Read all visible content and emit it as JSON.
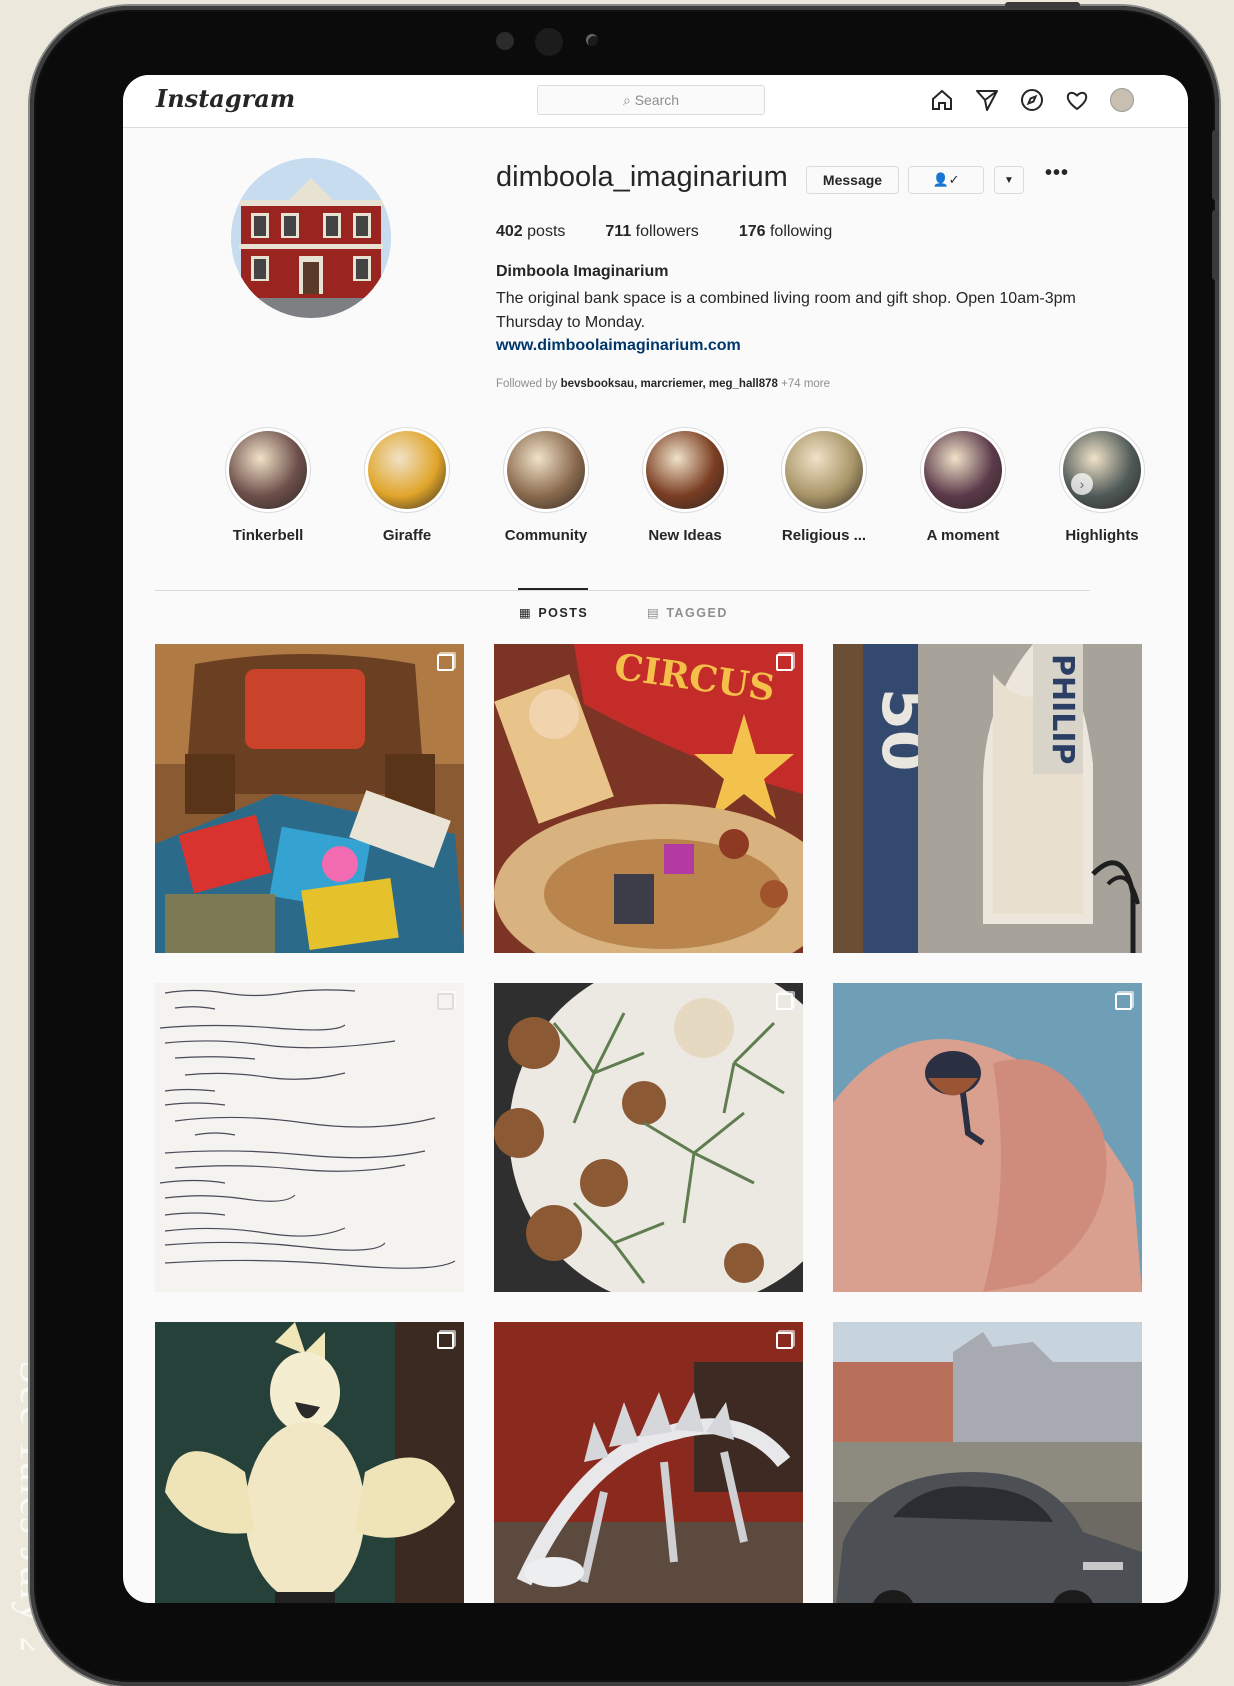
{
  "app": {
    "logo_text": "Instagram",
    "search_placeholder": "Search"
  },
  "nav": {
    "icons": [
      "home-icon",
      "direct-icon",
      "explore-icon",
      "activity-heart-icon",
      "profile-avatar-icon"
    ]
  },
  "profile": {
    "username": "dimboola_imaginarium",
    "message_button": "Message",
    "posts_count": "402",
    "posts_label": "posts",
    "followers_count": "711",
    "followers_label": "followers",
    "following_count": "176",
    "following_label": "following",
    "full_name": "Dimboola Imaginarium",
    "bio": "The original bank space is a combined living room and gift shop. Open 10am-3pm Thursday to Monday.",
    "website": "www.dimboolaimaginarium.com",
    "followed_prefix": "Followed by",
    "followed_names": "bevsbooksau, marcriemer, meg_hall878",
    "followed_more": "+74 more"
  },
  "highlights": [
    {
      "label": "Tinkerbell",
      "color": "#6d4f4a"
    },
    {
      "label": "Giraffe",
      "color": "#e0a52a"
    },
    {
      "label": "Community",
      "color": "#8a6a4e"
    },
    {
      "label": "New Ideas",
      "color": "#7a3d22"
    },
    {
      "label": "Religious ...",
      "color": "#a89567"
    },
    {
      "label": "A moment",
      "color": "#5b3a4a"
    },
    {
      "label": "Highlights",
      "color": "#4f5a58"
    }
  ],
  "tabs": {
    "posts": "POSTS",
    "tagged": "TAGGED"
  },
  "posts": [
    {
      "subject": "armchair with board games",
      "multi": true
    },
    {
      "subject": "toy circus scene",
      "multi": true
    },
    {
      "subject": "Philips 50 series radio",
      "multi": false
    },
    {
      "subject": "handwritten guest book page",
      "multi": true
    },
    {
      "subject": "snail shells with air plants",
      "multi": true
    },
    {
      "subject": "small bird in hand",
      "multi": true
    },
    {
      "subject": "white cockatoo puppet",
      "multi": true
    },
    {
      "subject": "silver stegosaurus skeleton",
      "multi": true
    },
    {
      "subject": "vintage car on street",
      "multi": false
    }
  ]
}
